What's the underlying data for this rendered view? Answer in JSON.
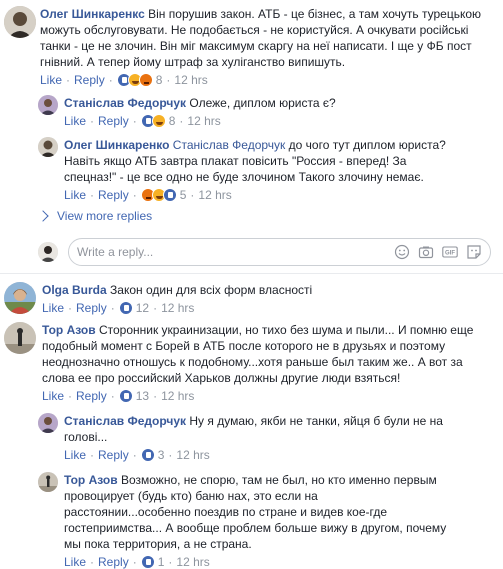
{
  "comments": [
    {
      "name": "Олег Шинкаренкс",
      "lines": [
        "Він порушив закон. АТБ - це бізнес, а там хочуть турецькою",
        "можуть обслуговувати. Не подобається - не користуйся. А очкувати російські",
        "танки - це не злочин. Він міг максимум скаргу на неї написати. І ще у ФБ пост",
        "гнівний. А тепер йому штраф за хуліганство випишуть."
      ],
      "like": "Like",
      "reply": "Reply",
      "count": "8",
      "time": "12 hrs"
    },
    {
      "name": "Станіслав Федорчук",
      "lines": [
        "Олеже, диплом юриста є?"
      ],
      "like": "Like",
      "reply": "Reply",
      "count": "8",
      "time": "12 hrs"
    },
    {
      "name": "Олег Шинкаренко",
      "tagged": "Станіслав Федорчук",
      "lines": [
        "до чого тут диплом юриста?",
        "Навіть якщо АТБ завтра плакат повісить \"Россия - вперед! За",
        "спецназ!\" - це все одно не буде злочином  Такого злочину немає."
      ],
      "like": "Like",
      "reply": "Reply",
      "count": "5",
      "time": "12 hrs"
    },
    {
      "name": "Olga Burda",
      "lines": [
        "Закон один для всіх форм власності"
      ],
      "like": "Like",
      "reply": "Reply",
      "count": "12",
      "time": "12 hrs"
    },
    {
      "name": "Тор Азов",
      "lines": [
        "Сторонник украинизации, но тихо без шума и пыли... И помню еще",
        "подобный момент с Борей в АТБ после которого не в друзьях и поэтому",
        "неоднозначно отношусь к подобному...хотя раньше был таким же.. А вот за",
        "слова ее про российский Харьков должны другие люди взяться!"
      ],
      "like": "Like",
      "reply": "Reply",
      "count": "13",
      "time": "12 hrs"
    },
    {
      "name": "Станіслав Федорчук",
      "lines": [
        "Ну я думаю, якби не танки, яйця б були не на",
        "голові..."
      ],
      "like": "Like",
      "reply": "Reply",
      "count": "3",
      "time": "12 hrs"
    },
    {
      "name": "Тор Азов",
      "lines": [
        "Возможно, не спорю, там не был, но кто именно первым",
        "провоцирует (будь кто) баню нах, это если на",
        "расстоянии...особенно поездив по стране и видев кое-где",
        "гостеприимства... А вообще проблем больше вижу в другом, почему",
        "мы пока территория, а не страна."
      ],
      "like": "Like",
      "reply": "Reply",
      "count": "1",
      "time": "12 hrs"
    }
  ],
  "view_more": "View more replies",
  "reply_box": {
    "placeholder": "Write a reply...",
    "gif": "GIF"
  },
  "icons": [
    "emoji-icon",
    "camera-icon",
    "gif-icon",
    "sticker-icon"
  ]
}
